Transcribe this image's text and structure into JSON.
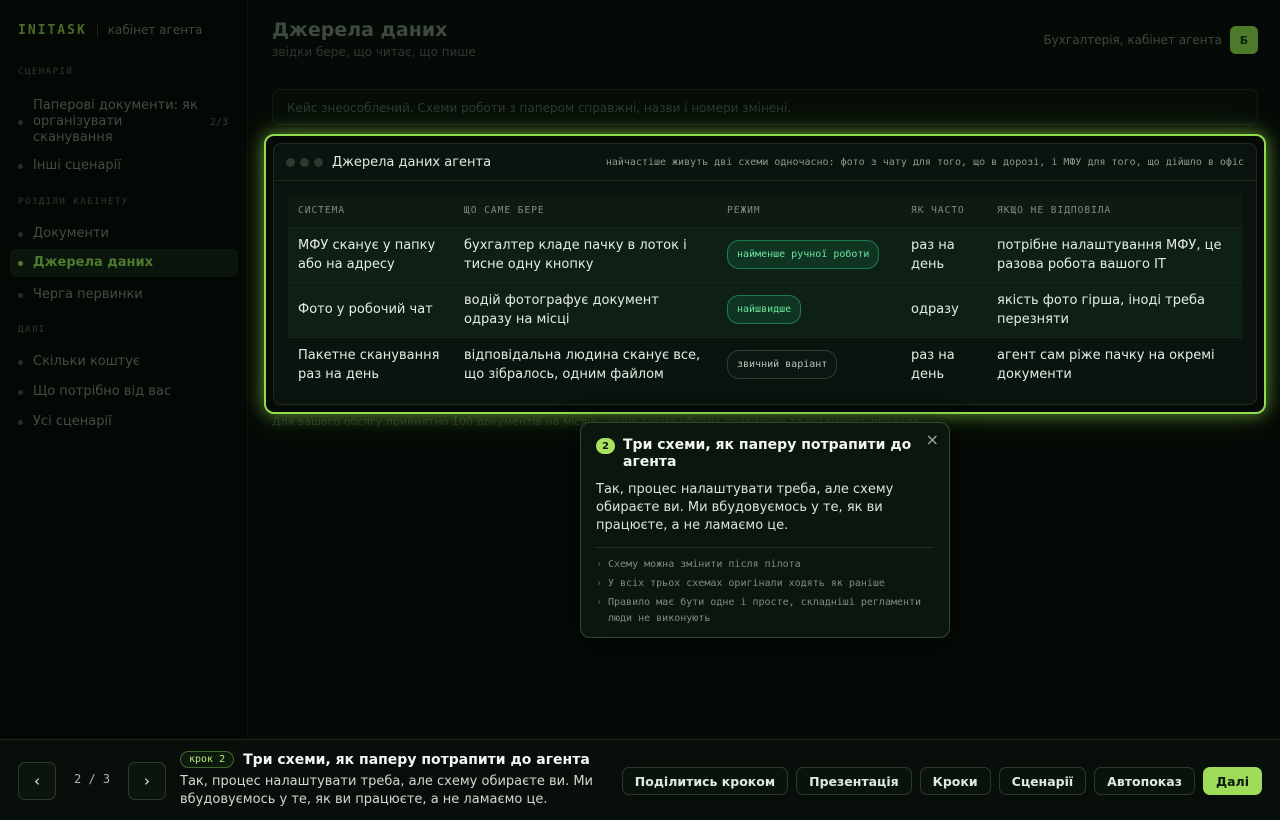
{
  "sidebar": {
    "brand": "INITASK",
    "brand_sub": "кабінет агента",
    "section_scenario": "СЦЕНАРІЙ",
    "scenario_items": [
      {
        "label": "Паперові документи: як організувати сканування",
        "count": "2/3"
      },
      {
        "label": "Інші сценарії"
      }
    ],
    "section_cabinet": "РОЗДІЛИ КАБІНЕТУ",
    "cabinet_items": [
      {
        "label": "Документи"
      },
      {
        "label": "Джерела даних"
      },
      {
        "label": "Черга первинки"
      }
    ],
    "section_further": "ДАЛІ",
    "further_items": [
      {
        "label": "Скільки коштує"
      },
      {
        "label": "Що потрібно від вас"
      },
      {
        "label": "Усі сценарії"
      }
    ]
  },
  "header": {
    "title": "Джерела даних",
    "subtitle": "звідки бере, що читає, що пише",
    "account_label": "Бухгалтерія, кабінет агента",
    "avatar": "Б"
  },
  "notice": "Кейс знеособлений. Схеми роботи з папером справжні, назви і номери змінені.",
  "footnote": "Для вашого обсягу прийнятно 100 документів на місяць, якщо схема обрана правильно та всі знають правило.",
  "card": {
    "title": "Джерела даних агента",
    "note": "найчастіше живуть дві схеми одночасно: фото з чату для того, що в дорозі, і МФУ для того, що дійшло в офіс",
    "columns": [
      "СИСТЕМА",
      "ЩО САМЕ БЕРЕ",
      "РЕЖИМ",
      "ЯК ЧАСТО",
      "ЯКЩО НЕ ВІДПОВІЛА"
    ],
    "rows": [
      {
        "system": "МФУ сканує у папку або на адресу",
        "takes": "бухгалтер кладе пачку в лоток і тисне одну кнопку",
        "mode": "найменше ручної роботи",
        "freq": "раз на день",
        "fallback": "потрібне налаштування МФУ, це разова робота вашого IT"
      },
      {
        "system": "Фото у робочий чат",
        "takes": "водій фотографує документ одразу на місці",
        "mode": "найшвидше",
        "freq": "одразу",
        "fallback": "якість фото гірша, іноді треба перезняти"
      },
      {
        "system": "Пакетне сканування раз на день",
        "takes": "відповідальна людина сканує все, що зібралось, одним файлом",
        "mode": "звичний варіант",
        "freq": "раз на день",
        "fallback": "агент сам ріже пачку на окремі документи"
      }
    ]
  },
  "popover": {
    "step": "2",
    "title": "Три схеми, як паперу потрапити до агента",
    "body": "Так, процес налаштувати треба, але схему обираєте ви. Ми вбудовуємось у те, як ви працюєте, а не ламаємо це.",
    "bullets": [
      "Схему можна змінити після пілота",
      "У всіх трьох схемах оригінали ходять як раніше",
      "Правило має бути одне і просте, складніші регламенти люди не виконують"
    ],
    "close": "×"
  },
  "bottom": {
    "prev": "‹",
    "next": "›",
    "counter": "2 / 3",
    "step_badge": "крок 2",
    "step_title": "Три схеми, як паперу потрапити до агента",
    "step_desc": "Так, процес налаштувати треба, але схему обираєте ви. Ми вбудовуємось у те, як ви працюєте, а не ламаємо це.",
    "actions": [
      "Поділитись кроком",
      "Презентація",
      "Кроки",
      "Сценарії",
      "Автопоказ",
      "Далі"
    ]
  },
  "colors": {
    "accent": "#9fdc59",
    "tag_green": "#6be39c",
    "background": "#050a06"
  }
}
